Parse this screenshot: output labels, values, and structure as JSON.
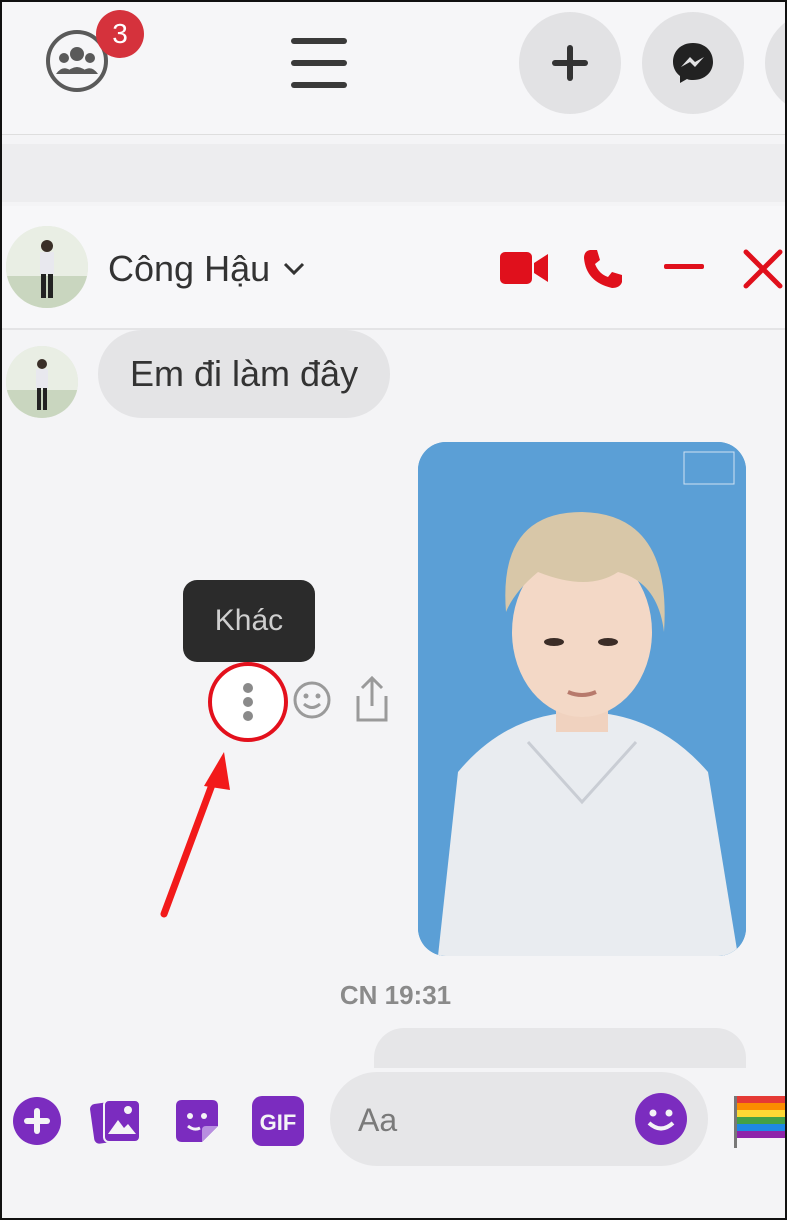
{
  "topbar": {
    "group_badge_count": "3",
    "icons": [
      "group-icon",
      "hamburger-menu-icon",
      "plus-icon",
      "messenger-icon"
    ]
  },
  "chat": {
    "contact_name": "Công Hậu",
    "incoming_message": "Em đi làm đây",
    "tooltip": "Khác",
    "timestamp": "CN 19:31",
    "input_placeholder": "Aa",
    "accent_color": "#e0101c",
    "composer_color": "#7b2cbf"
  }
}
